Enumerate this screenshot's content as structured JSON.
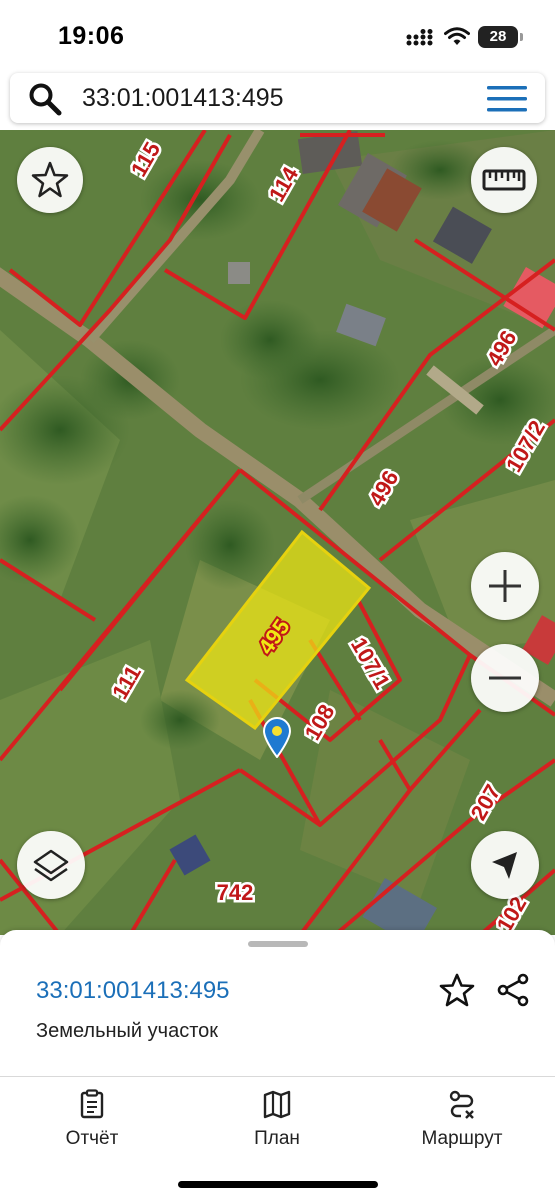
{
  "status_bar": {
    "time": "19:06",
    "battery": "28"
  },
  "search": {
    "query": "33:01:001413:495"
  },
  "map": {
    "selected_parcel_label": "495",
    "parcel_labels": [
      {
        "id": "p115",
        "text": "115"
      },
      {
        "id": "p114",
        "text": "114"
      },
      {
        "id": "p496a",
        "text": "496"
      },
      {
        "id": "p107_2",
        "text": "107/2"
      },
      {
        "id": "p496b",
        "text": "496"
      },
      {
        "id": "p111",
        "text": "111"
      },
      {
        "id": "p107_1",
        "text": "107/1"
      },
      {
        "id": "p108",
        "text": "108"
      },
      {
        "id": "p207",
        "text": "207"
      },
      {
        "id": "p742",
        "text": "742"
      },
      {
        "id": "p102",
        "text": "102"
      }
    ],
    "icons": [
      "star-outline-icon",
      "ruler-icon",
      "zoom-in-icon",
      "zoom-out-icon",
      "layers-icon",
      "navigation-arrow-icon",
      "location-pin-icon"
    ],
    "colors": {
      "boundary": "#d62020",
      "selected_fill": "#f0e814",
      "selected_stroke": "#e6d20f",
      "pin": "#1f7ad1",
      "label": "#c01818"
    }
  },
  "sheet": {
    "cadastral_number": "33:01:001413:495",
    "type": "Земельный участок"
  },
  "tabs": [
    {
      "label": "Отчёт",
      "icon": "report-clipboard-icon"
    },
    {
      "label": "План",
      "icon": "map-plan-icon"
    },
    {
      "label": "Маршрут",
      "icon": "route-icon"
    }
  ],
  "accent_color": "#1b6fb8"
}
